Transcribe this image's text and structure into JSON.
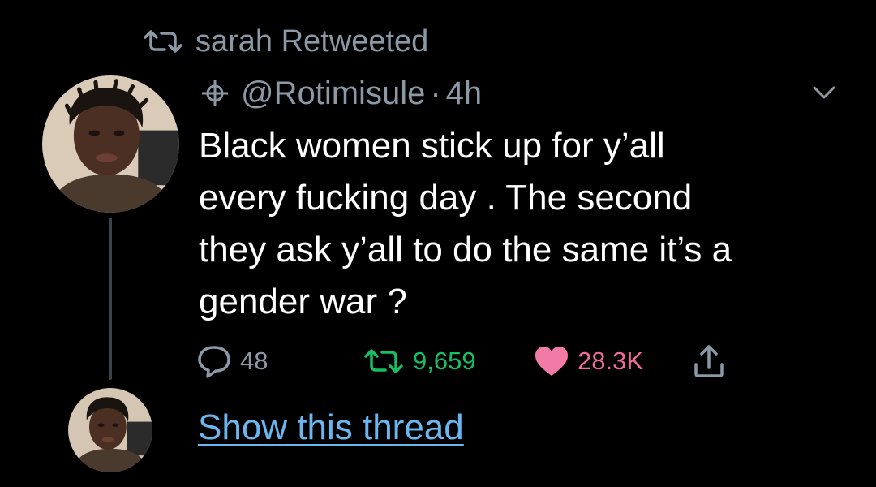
{
  "retweet_header": {
    "icon": "retweet-icon",
    "text": "sarah Retweeted"
  },
  "tweet": {
    "handle": "@Rotimisule",
    "separator": "·",
    "time": "4h",
    "text": "Black women stick up for y’all\nevery fucking day . The second\nthey ask y’all to do the same it’s a\ngender war ?",
    "actions": {
      "reply": {
        "icon": "reply-icon",
        "count": "48"
      },
      "retweet": {
        "icon": "retweet-icon",
        "count": "9,659"
      },
      "like": {
        "icon": "heart-icon",
        "count": "28.3K"
      },
      "share": {
        "icon": "share-icon"
      }
    },
    "show_thread": "Show this thread"
  },
  "colors": {
    "background": "#000000",
    "secondary_text": "#8b98a5",
    "retweet_green": "#17bf63",
    "like_pink": "#e0245e",
    "link_blue": "#6ab7f0",
    "thread_line": "#38444d"
  }
}
